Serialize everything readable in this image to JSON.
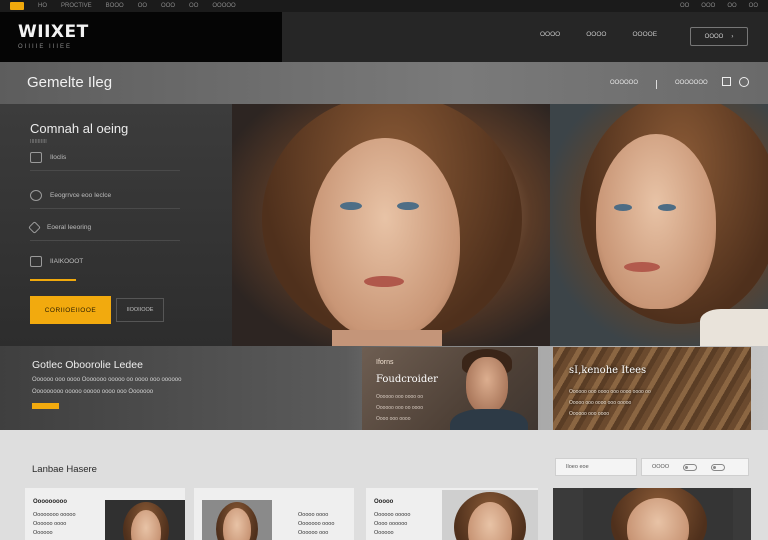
{
  "topbar": {
    "items": [
      "HO",
      "PROCTIVE",
      "BOOO",
      "OO",
      "OOO",
      "OO",
      "OOOOO"
    ],
    "right_items": [
      "OO",
      "OOO",
      "OO",
      "OO"
    ]
  },
  "brand": {
    "name": "WIIXET",
    "tagline": "OIIIIE IIIEE"
  },
  "nav": {
    "items": [
      "OOOO",
      "OOOO",
      "OOOOE"
    ],
    "cta_label": "OOOO"
  },
  "title_bar": {
    "title": "Gemelte Ileg",
    "links": [
      "OOOOOO",
      "OOOOOOO"
    ]
  },
  "hero": {
    "heading": "Comnah al oeing",
    "subtitle": "IIIIIIIIIII",
    "features": [
      {
        "icon": "box-icon",
        "label": "Iloclis"
      },
      {
        "icon": "clock-icon",
        "label": "Eeogrrvce eoo Ieclce"
      },
      {
        "icon": "diamond-icon",
        "label": "Eoeral Ieeoring"
      },
      {
        "icon": "car-icon",
        "label": "IIAIKOOOT"
      }
    ],
    "primary_button": "CORIIOEIIOOE",
    "secondary_button": "IIOOIIOOE",
    "accent_color": "#f2aa0e"
  },
  "mid_band": {
    "heading": "Gotlec Oboorolie Ledee",
    "lines": [
      "Oooooo ooo oooo Ooooooo ooooo oo oooo ooo oooooo",
      "Ooooooooo ooooo ooooo oooo ooo Ooooooo"
    ]
  },
  "card_portrait": {
    "label": "Iforns",
    "title": "Foudcroider",
    "lines": [
      "Oooooo ooo oooo oo",
      "Oooooo ooo oo oooo",
      "Oooo ooo oooo"
    ]
  },
  "card_wood": {
    "title": "sI,kenohe Itees",
    "lines": [
      "Oooooo ooo oooo ooo oooo oooo oo",
      "Ooooo ooo oooo ooo ooooo",
      "Oooooo ooo oooo"
    ]
  },
  "bottom": {
    "section_title": "Lanbae Hasere",
    "filter_label": "Iloeo eoe",
    "filter_label_2": "OOOO",
    "cards": [
      {
        "title": "Ooooooooo",
        "lines": [
          "Oooooooo ooooo",
          "Oooooo oooo",
          "Oooooo"
        ]
      },
      {
        "title": "",
        "lines": [
          "Ooooo oooo",
          "Ooooooo oooo",
          "Oooooo ooo"
        ]
      },
      {
        "title": "Ooooo",
        "lines": [
          "Oooooo ooooo",
          "Oooo oooooo",
          "Oooooo"
        ]
      }
    ]
  }
}
